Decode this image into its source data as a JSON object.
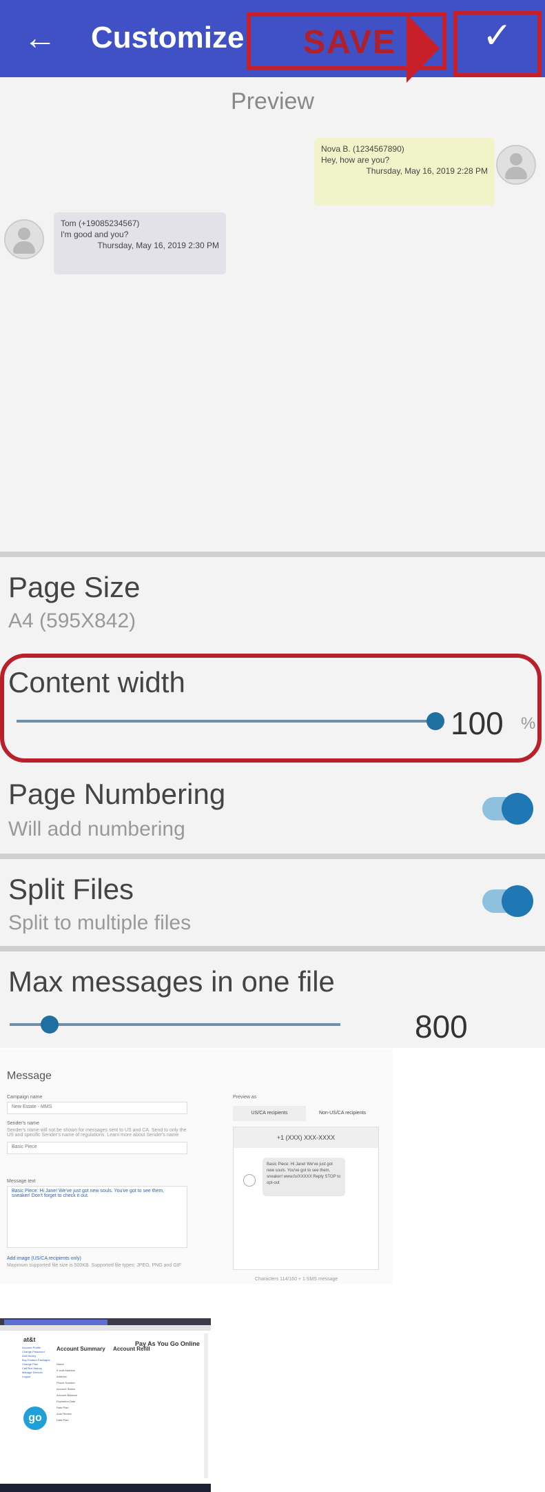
{
  "appbar": {
    "back_icon": "arrow-left-icon",
    "title": "Customize",
    "save_callout": "SAVE",
    "confirm_icon": "check-icon",
    "color": "#3f51c4",
    "annotation_color": "#c8202a"
  },
  "preview": {
    "label": "Preview",
    "outgoing": {
      "sender": "Nova B. (1234567890)",
      "text": "Hey, how are you?",
      "time": "Thursday, May 16, 2019 2:28 PM"
    },
    "incoming": {
      "sender": "Tom (+19085234567)",
      "text": "I'm good and you?",
      "time": "Thursday, May 16, 2019 2:30 PM"
    }
  },
  "settings": {
    "page_size": {
      "title": "Page Size",
      "value": "A4 (595X842)"
    },
    "content_width": {
      "title": "Content width",
      "value": "100",
      "unit": "%",
      "level_percent": 100
    },
    "page_numbering": {
      "title": "Page Numbering",
      "subtitle": "Will add numbering",
      "enabled": true
    },
    "split_files": {
      "title": "Split Files",
      "subtitle": "Split to multiple files",
      "enabled": true
    },
    "max_messages": {
      "title": "Max messages in one file",
      "value": "800",
      "level_percent": 12
    }
  },
  "composer": {
    "heading": "Message",
    "campaign_label": "Campaign name",
    "campaign_value": "New Estate - MMS",
    "sender_label": "Sender's name",
    "sender_help": "Sender's name will not be shown for messages sent to US and CA. Send to only the US and specific Sender's name of regulations. Learn more about Sender's name",
    "sender_value": "Basic Piece",
    "message_label": "Message text",
    "message_value": "Basic Piece: Hi Jane! We've just got new souls. You've got to see them, sneaker! Don't forget to check it out.",
    "image_label": "Add image (US/CA recipients only)",
    "image_help": "Maximum supported file size is 500KB. Supported file types: JPEG, PNG and GIF",
    "preview_label": "Preview as",
    "tab_us": "US/CA recipients",
    "tab_non_us": "Non-US/CA recipients",
    "phone_number": "+1 (XXX) XXX-XXXX",
    "bubble_text": "Basic Piece: Hi Jane! We've just got new souls. You've got to see them, sneaker! www.fo/XXXXX Reply STOP to opt-out",
    "char_count": "Characters 114/160 + 1 SMS message"
  },
  "desktop": {
    "brand": "at&t",
    "header_title": "Pay As You Go Online",
    "summary_title": "Account Summary",
    "refill_title": "Account Refill",
    "badge": "go",
    "nav_items": [
      "Account Profile",
      "Change Password",
      "Add Money",
      "Buy Feature Packages",
      "Change Plan",
      "Call/Text History",
      "Manage Devices",
      "Logout"
    ],
    "rows": [
      "Name",
      "E-mail Address",
      "Address",
      "Phone Number",
      "Account Status",
      "Account Balance",
      "Expiration Date",
      "Rate Plan",
      "Auto Renew",
      "Data Plan"
    ]
  }
}
